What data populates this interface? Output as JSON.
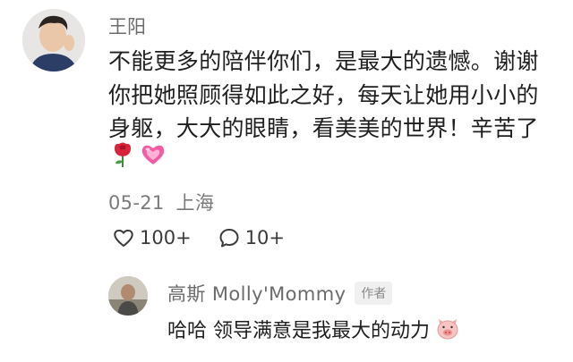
{
  "comment": {
    "author_name": "王阳",
    "text": "不能更多的陪伴你们，是最大的遗憾。谢谢你把她照顾得如此之好，每天让她用小小的身躯，大大的眼睛，看美美的世界！辛苦了",
    "emojis": [
      "rose-icon",
      "heart-icon"
    ],
    "date": "05-21",
    "location": "上海",
    "like_count": "100+",
    "reply_count": "10+"
  },
  "reply": {
    "author_name": "高斯 Molly'Mommy",
    "badge": "作者",
    "text": "哈哈 领导满意是我最大的动力",
    "emoji": "pig-face-icon"
  }
}
